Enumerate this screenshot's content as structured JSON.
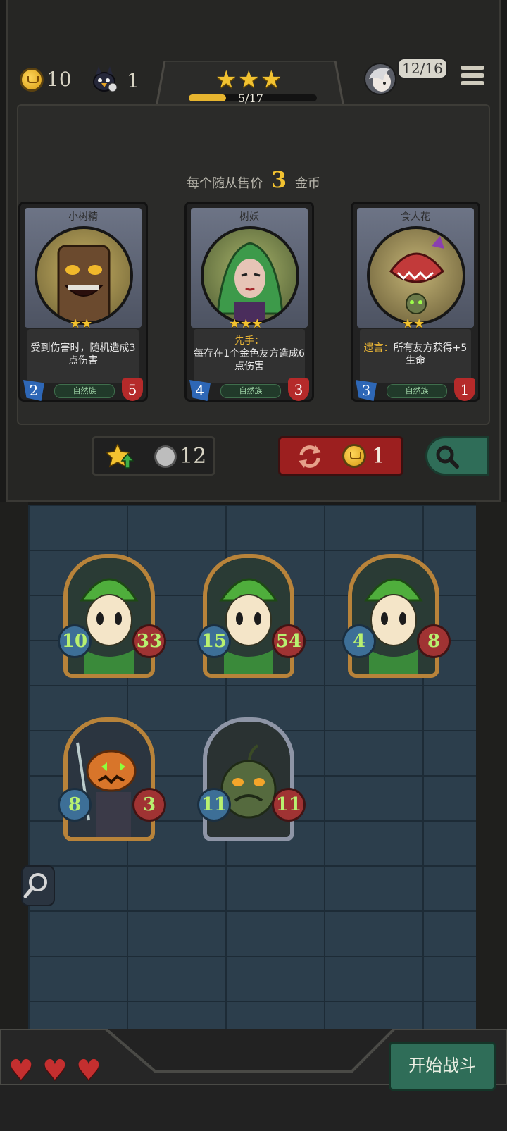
{
  "hud": {
    "gold": "10",
    "rank_count": "1",
    "xp_progress_text": "5/17",
    "xp_progress_fraction": 0.29,
    "tavern_stars": 3,
    "players_text": "12/16"
  },
  "shop": {
    "price_prefix": "每个随从售价",
    "price_value": "3",
    "price_suffix": "金币",
    "cards": [
      {
        "name": "小树精",
        "stars": "★★",
        "desc_kw": "",
        "desc": "受到伤害时，随机造成3点伤害",
        "tribe": "自然族",
        "attack": "2",
        "health": "5"
      },
      {
        "name": "树妖",
        "stars": "★★★",
        "desc_kw": "先手：",
        "desc": "每存在1个金色友方造成6点伤害",
        "tribe": "自然族",
        "attack": "4",
        "health": "3"
      },
      {
        "name": "食人花",
        "stars": "★★",
        "desc_kw": "遗言：",
        "desc": "所有友方获得+5生命",
        "tribe": "自然族",
        "attack": "3",
        "health": "1"
      }
    ],
    "upgrade_cost": "12",
    "refresh_cost": "1"
  },
  "board": {
    "minions": [
      {
        "name": "sprout",
        "attack": "10",
        "health": "33",
        "frame": "gold"
      },
      {
        "name": "sprout",
        "attack": "15",
        "health": "54",
        "frame": "gold"
      },
      {
        "name": "sprout",
        "attack": "4",
        "health": "8",
        "frame": "gold"
      },
      {
        "name": "pumpkin-reaper",
        "attack": "8",
        "health": "3",
        "frame": "gold"
      },
      {
        "name": "swamp-blob",
        "attack": "11",
        "health": "11",
        "frame": "silver"
      }
    ]
  },
  "footer": {
    "lives": 3,
    "start_battle": "开始战斗"
  },
  "colors": {
    "accent_gold": "#f2c230",
    "refresh_red": "#9c1f1f",
    "action_green": "#2f6d58"
  }
}
